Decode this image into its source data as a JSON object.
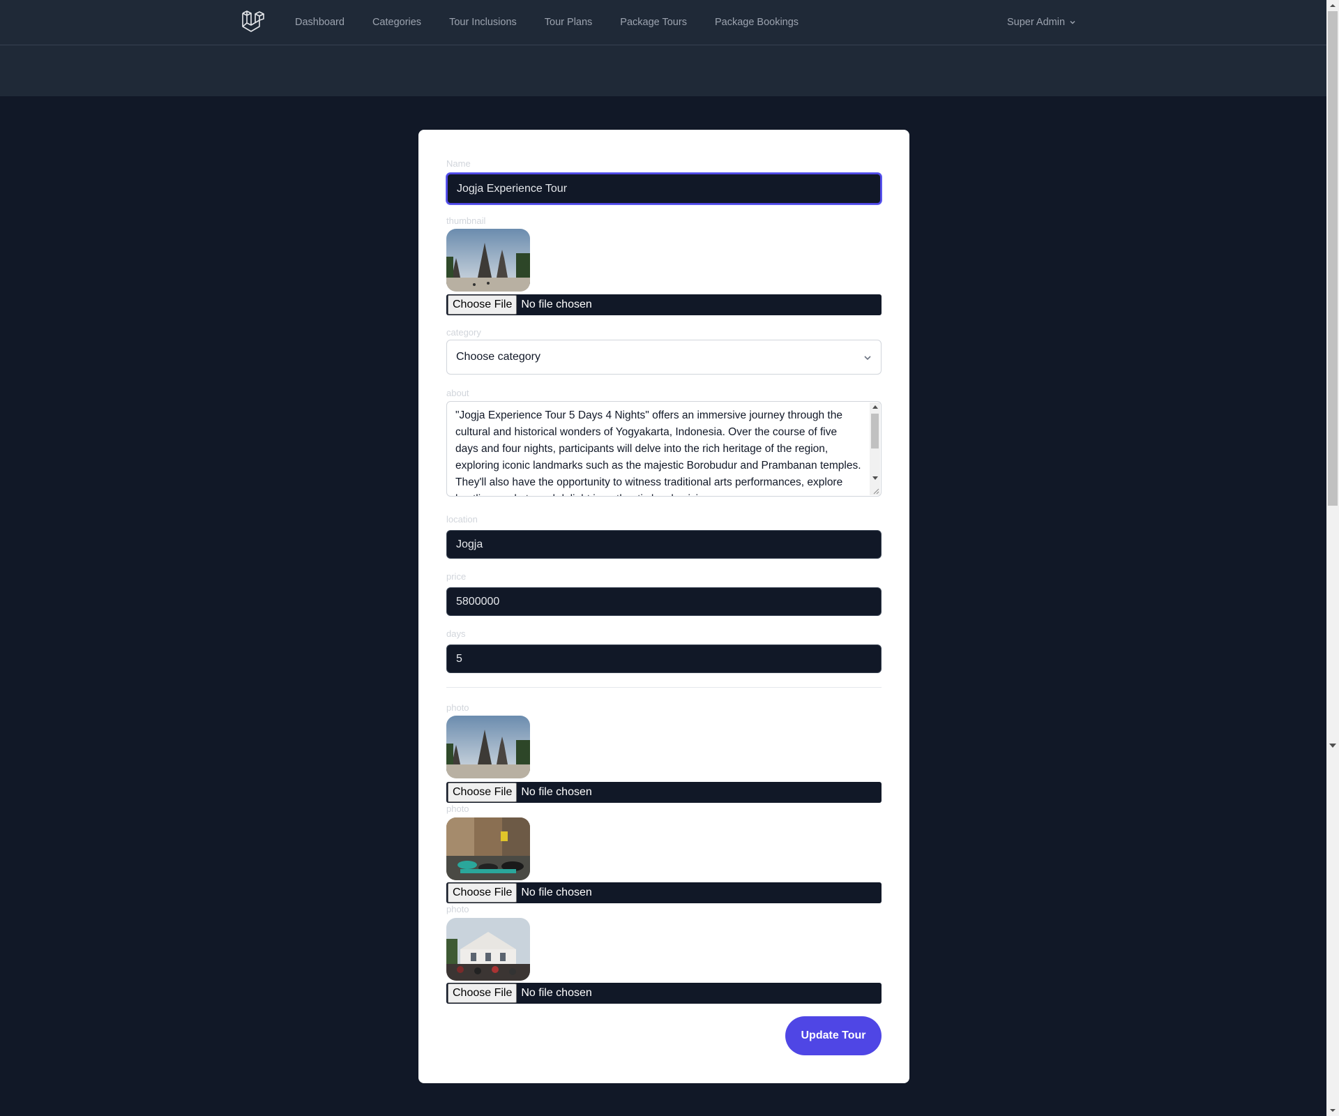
{
  "nav": {
    "logo_icon": "laravel-logo-icon",
    "links": [
      "Dashboard",
      "Categories",
      "Tour Inclusions",
      "Tour Plans",
      "Package Tours",
      "Package Bookings"
    ],
    "user_name": "Super Admin",
    "user_menu_icon": "chevron-down-icon"
  },
  "form": {
    "name_label": "Name",
    "name_value": "Jogja Experience Tour",
    "thumbnail_label": "thumbnail",
    "thumbnail_image": "temple-photo",
    "file_button": "Choose File",
    "file_status": "No file chosen",
    "category_label": "category",
    "category_value": "Choose category",
    "about_label": "about",
    "about_value": "\"Jogja Experience Tour 5 Days 4 Nights\" offers an immersive journey through the cultural and historical wonders of Yogyakarta, Indonesia. Over the course of five days and four nights, participants will delve into the rich heritage of the region, exploring iconic landmarks such as the majestic Borobudur and Prambanan temples. They'll also have the opportunity to witness traditional arts performances, explore bustling markets and delight in authentic local cuisine.",
    "location_label": "location",
    "location_value": "Jogja",
    "price_label": "price",
    "price_value": "5800000",
    "days_label": "days",
    "days_value": "5",
    "photos": [
      {
        "label": "photo",
        "image": "temple-photo"
      },
      {
        "label": "photo",
        "image": "street-becak-photo"
      },
      {
        "label": "photo",
        "image": "crowd-building-photo"
      }
    ],
    "submit_label": "Update Tour"
  },
  "colors": {
    "page_bg": "#111827",
    "nav_bg": "#1f2937",
    "accent": "#4f46e5",
    "input_bg": "#111827"
  }
}
